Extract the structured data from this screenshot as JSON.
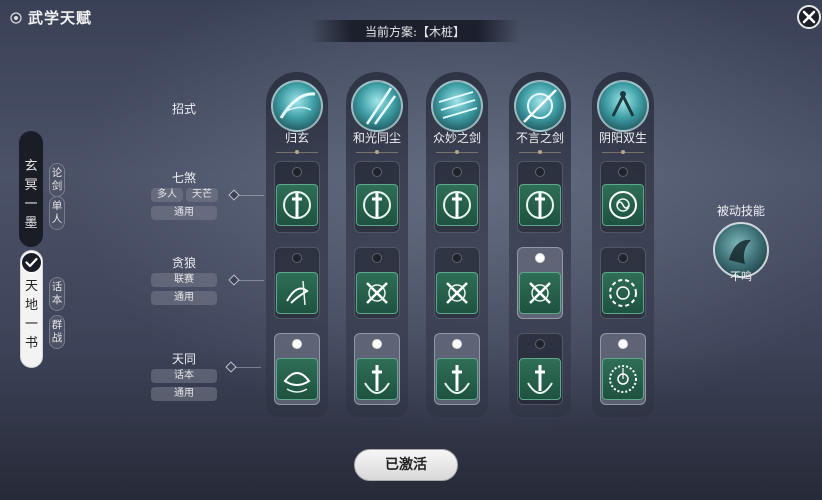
{
  "header": {
    "title": "武学天赋",
    "scheme_text": "当前方案:【木桩】"
  },
  "left_tabs": {
    "tab1_chars": [
      "玄",
      "冥",
      "一",
      "墨"
    ],
    "tab1_sub1": [
      "论",
      "剑"
    ],
    "tab1_sub2": [
      "单",
      "人"
    ],
    "tab2_chars": [
      "天",
      "地",
      "一",
      "书"
    ],
    "tab2_sub1": [
      "话",
      "本"
    ],
    "tab2_sub2": [
      "群",
      "战"
    ]
  },
  "row_header": "招式",
  "rows": [
    {
      "name": "七煞",
      "tags": [
        "多人",
        "天芒"
      ],
      "tag2": "通用"
    },
    {
      "name": "贪狼",
      "tags": [
        "联赛"
      ],
      "tag2": "通用"
    },
    {
      "name": "天同",
      "tags": [
        "话本"
      ],
      "tag2": "通用"
    }
  ],
  "columns": [
    {
      "name": "归玄",
      "icon": "slash-orb-icon",
      "card_icons": [
        "sword-emblem-icon",
        "wind-swirl-icon",
        "leaf-emblem-icon"
      ],
      "selected": [
        false,
        false,
        true
      ]
    },
    {
      "name": "和光同尘",
      "icon": "blade-strike-icon",
      "card_icons": [
        "sword-emblem-icon",
        "cross-swirl-icon",
        "sword-emblem-icon"
      ],
      "selected": [
        false,
        false,
        true
      ]
    },
    {
      "name": "众妙之剑",
      "icon": "sword-rain-icon",
      "card_icons": [
        "sword-emblem-icon",
        "cross-swirl-icon",
        "sword-emblem-icon"
      ],
      "selected": [
        false,
        false,
        true
      ]
    },
    {
      "name": "不言之剑",
      "icon": "vortex-sword-icon",
      "card_icons": [
        "sword-emblem-icon",
        "cross-swirl-icon",
        "sword-emblem-icon"
      ],
      "selected": [
        false,
        true,
        false
      ]
    },
    {
      "name": "阴阳双生",
      "icon": "yin-yang-figure-icon",
      "card_icons": [
        "taiji-icon",
        "taiji-ring-icon",
        "taiji-clock-icon"
      ],
      "selected": [
        false,
        false,
        true
      ]
    }
  ],
  "passive": {
    "label": "被动技能",
    "name": "不鸣"
  },
  "activate_label": "已激活",
  "colors": {
    "accent_green": "#2f6e57",
    "card_border": "#5fa88a",
    "bg_dark": "#3a4157"
  }
}
